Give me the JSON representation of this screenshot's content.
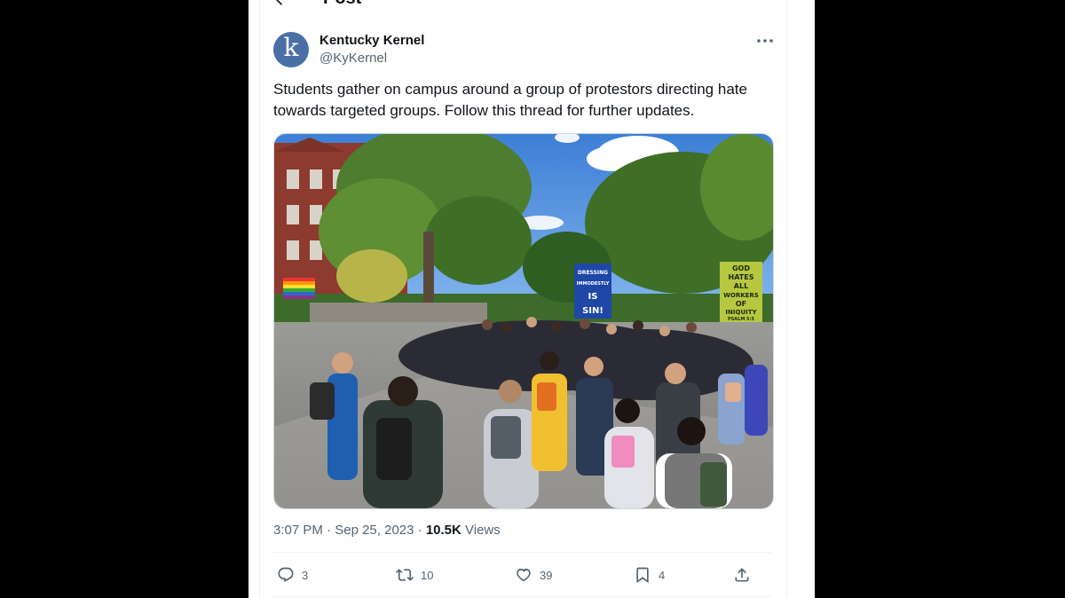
{
  "header": {
    "title": "Post"
  },
  "author": {
    "display_name": "Kentucky Kernel",
    "handle": "@KyKernel",
    "avatar_letter": "k"
  },
  "tweet": {
    "text": "Students gather on campus around a group of protestors directing hate towards targeted groups. Follow this thread for further updates."
  },
  "media": {
    "signs": {
      "blue_sign_lines": [
        "DRESSING",
        "IMMODESTLY",
        "IS",
        "SIN!"
      ],
      "green_sign_lines": [
        "GOD",
        "HATES",
        "ALL",
        "WORKERS",
        "OF",
        "INIQUITY",
        "PSALM 5:5"
      ]
    }
  },
  "meta": {
    "time": "3:07 PM",
    "separator": "·",
    "date": "Sep 25, 2023",
    "views_count": "10.5K",
    "views_label": "Views"
  },
  "actions": {
    "replies": "3",
    "reposts": "10",
    "likes": "39",
    "bookmarks": "4"
  },
  "colors": {
    "accent": "#1d9bf0",
    "muted_text": "#536471",
    "avatar_bg": "#4a6fa5"
  }
}
